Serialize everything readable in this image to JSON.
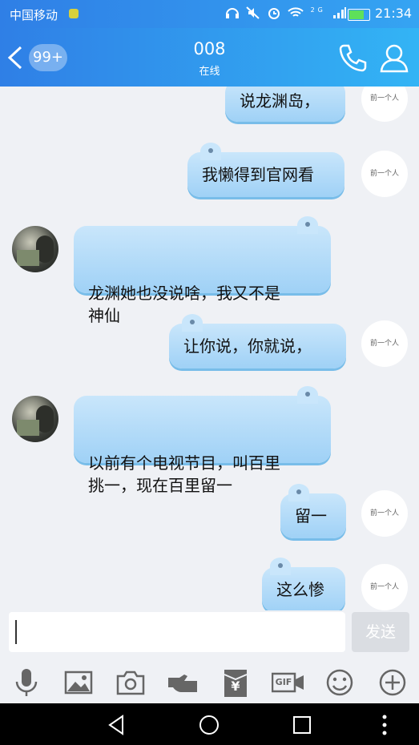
{
  "status": {
    "carrier": "中国移动",
    "network": "2G",
    "time": "21:34"
  },
  "header": {
    "unread_badge": "99+",
    "title": "008",
    "subtitle": "在线"
  },
  "messages": [
    {
      "side": "self",
      "text": "说龙渊岛，"
    },
    {
      "side": "self",
      "text": "我懒得到官网看"
    },
    {
      "side": "other",
      "text": "龙渊她也没说啥，我又不是\n神仙"
    },
    {
      "side": "self",
      "text": "让你说，你就说，"
    },
    {
      "side": "other",
      "text": "以前有个电视节目，叫百里\n挑一，现在百里留一"
    },
    {
      "side": "self",
      "text": "留一"
    },
    {
      "side": "self",
      "text": "这么惨"
    }
  ],
  "self_avatar_text": "前一个人",
  "composer": {
    "value": "",
    "send_label": "发送"
  },
  "toolbar_icons": [
    "microphone-icon",
    "image-icon",
    "camera-icon",
    "red-packet-icon",
    "yuan-icon",
    "gif-icon",
    "emoji-icon",
    "plus-icon"
  ],
  "toolbar": {
    "gif_label": "GIF",
    "yuan_label": "¥"
  },
  "colors": {
    "header_gradient_start": "#2f7fe6",
    "header_gradient_end": "#33b4f5",
    "bubble": "#b4dcf8"
  }
}
